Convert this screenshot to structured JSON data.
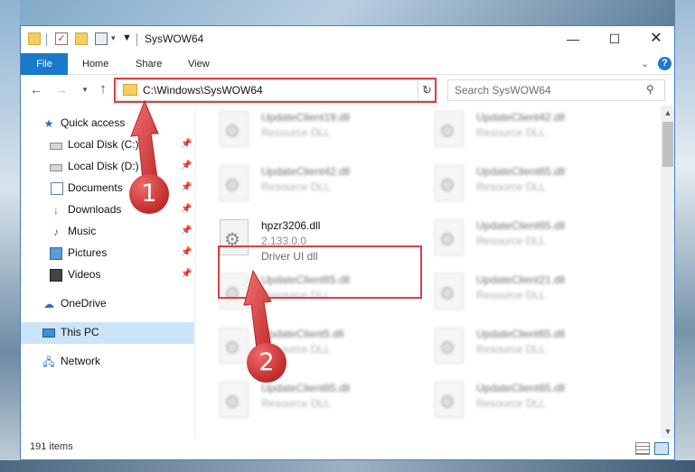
{
  "window": {
    "title": "SysWOW64",
    "controls": {
      "minimize": "—",
      "maximize": "☐",
      "close": "✕"
    }
  },
  "ribbon": {
    "tabs": [
      "File",
      "Home",
      "Share",
      "View"
    ],
    "help": "?"
  },
  "address": {
    "path": "C:\\Windows\\SysWOW64",
    "search_placeholder": "Search SysWOW64"
  },
  "sidebar": {
    "items": [
      {
        "label": "Quick access",
        "icon": "star-icon",
        "pinned": false
      },
      {
        "label": "Local Disk (C:)",
        "icon": "drive-icon",
        "pinned": true
      },
      {
        "label": "Local Disk (D:)",
        "icon": "drive-icon",
        "pinned": true
      },
      {
        "label": "Documents",
        "icon": "documents-icon",
        "pinned": true
      },
      {
        "label": "Downloads",
        "icon": "download-arrow-icon",
        "pinned": true
      },
      {
        "label": "Music",
        "icon": "music-note-icon",
        "pinned": true
      },
      {
        "label": "Pictures",
        "icon": "pictures-icon",
        "pinned": true
      },
      {
        "label": "Videos",
        "icon": "film-icon",
        "pinned": true
      },
      {
        "label": "OneDrive",
        "icon": "cloud-icon",
        "pinned": false
      },
      {
        "label": "This PC",
        "icon": "computer-icon",
        "pinned": false,
        "selected": true
      },
      {
        "label": "Network",
        "icon": "network-icon",
        "pinned": false
      }
    ]
  },
  "files": [
    {
      "name": "UpdateClient19.dll",
      "type": "Resource DLL",
      "blurred": true
    },
    {
      "name": "UpdateClient42.dll",
      "type": "Resource DLL",
      "blurred": true
    },
    {
      "name": "UpdateClient42.dll",
      "type": "Resource DLL",
      "blurred": true
    },
    {
      "name": "UpdateClient65.dll",
      "type": "Resource DLL",
      "blurred": true
    },
    {
      "name": "hpzr3206.dll",
      "version": "2.133.0.0",
      "type": "Driver UI dll",
      "blurred": false,
      "highlighted": true
    },
    {
      "name": "UpdateClient65.dll",
      "type": "Resource DLL",
      "blurred": true
    },
    {
      "name": "UpdateClient65.dll",
      "type": "Resource DLL",
      "blurred": true
    },
    {
      "name": "UpdateClient21.dll",
      "type": "Resource DLL",
      "blurred": true
    },
    {
      "name": "UpdateClient5.dll",
      "type": "Resource DLL",
      "blurred": true
    },
    {
      "name": "UpdateClient65.dll",
      "type": "Resource DLL",
      "blurred": true
    },
    {
      "name": "UpdateClient65.dll",
      "type": "Resource DLL",
      "blurred": true
    },
    {
      "name": "UpdateClient65.dll",
      "type": "Resource DLL",
      "blurred": true
    }
  ],
  "status": {
    "item_count": "191 items"
  },
  "callouts": [
    "1",
    "2"
  ],
  "colors": {
    "accent": "#1979ca",
    "highlight": "#d94141",
    "selected_nav": "#cce4f7"
  }
}
